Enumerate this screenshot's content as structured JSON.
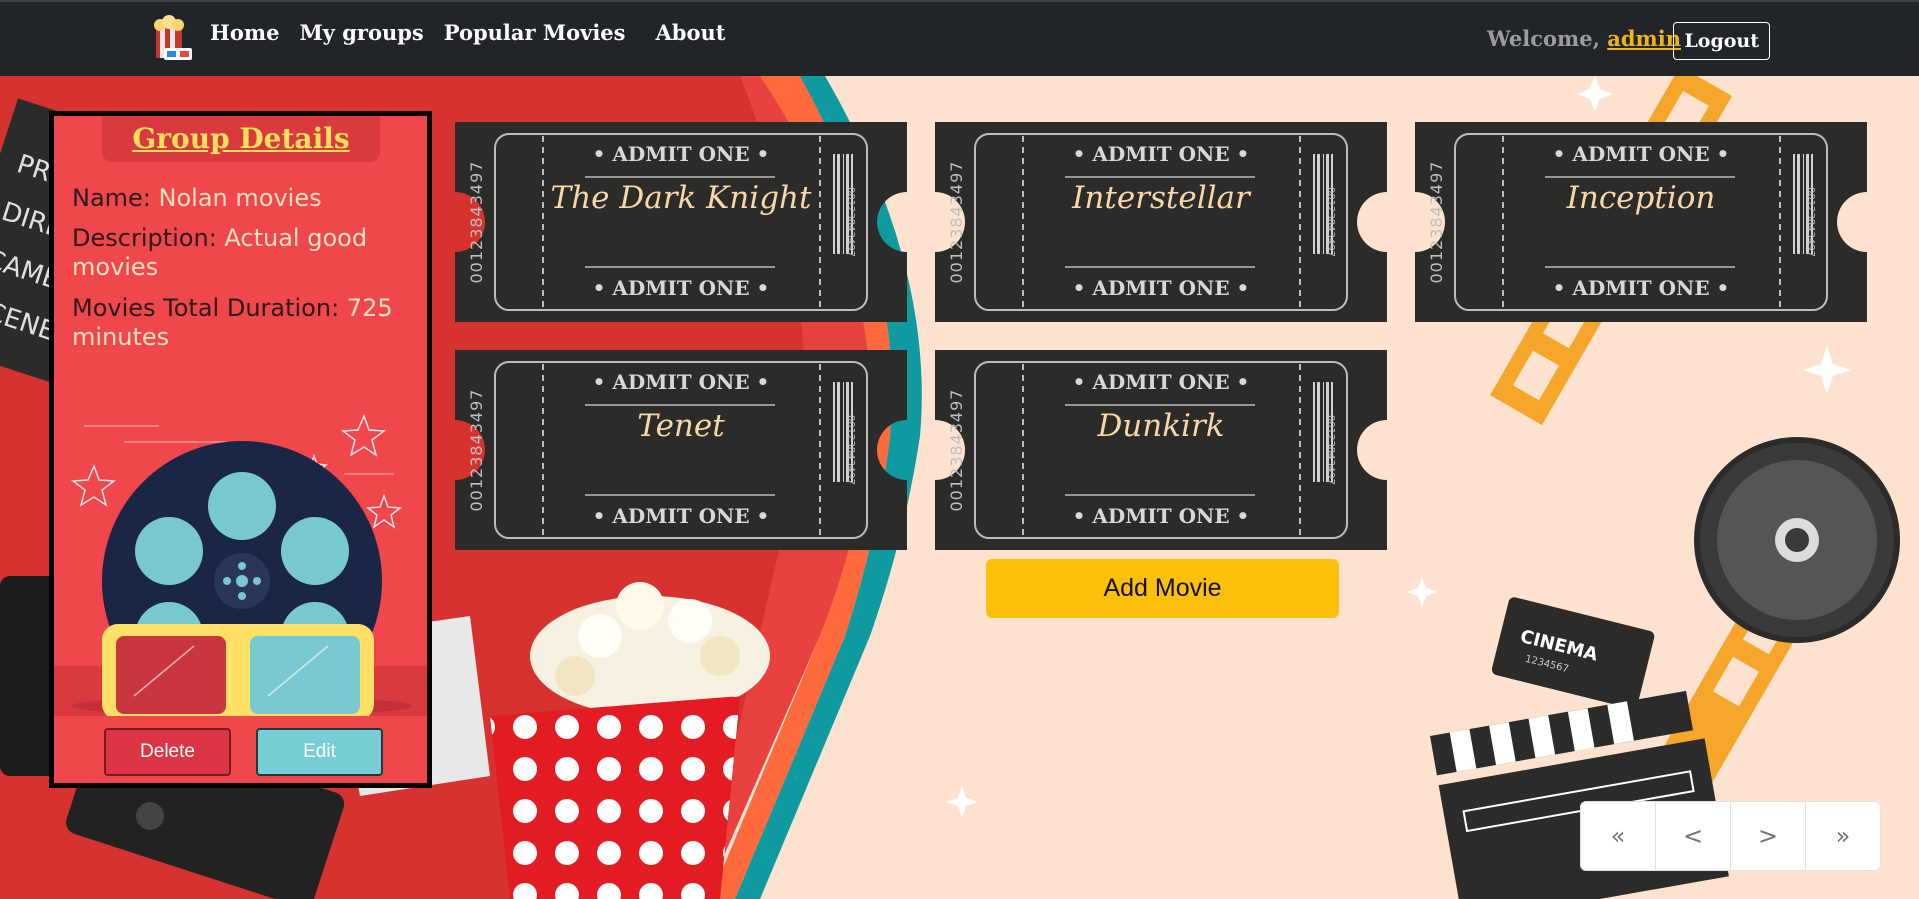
{
  "nav": {
    "links": [
      "Home",
      "My groups",
      "Popular Movies",
      "About"
    ],
    "welcome_prefix": "Welcome, ",
    "username": "admin",
    "logout_label": "Logout"
  },
  "group": {
    "title": "Group Details",
    "name_label": "Name: ",
    "name_value": "Nolan movies",
    "description_label": "Description: ",
    "description_value": "Actual good movies",
    "duration_label": "Movies Total Duration: ",
    "duration_value": "725 minutes",
    "delete_label": "Delete",
    "edit_label": "Edit"
  },
  "tickets": {
    "admit_text": "• ADMIT ONE •",
    "serial": "00123843497",
    "movies": [
      "The Dark Knight",
      "Interstellar",
      "Inception",
      "Tenet",
      "Dunkirk"
    ]
  },
  "add_movie_label": "Add Movie",
  "pagination": [
    "«",
    "<",
    ">",
    "»"
  ],
  "decor": {
    "cinema_ticket_text": "CINEMA",
    "cinema_ticket_number": "1234567"
  },
  "colors": {
    "navbar": "#21252a",
    "accent_yellow": "#fcbf0a",
    "panel_red": "#f0474d",
    "delete_red": "#dc3545",
    "edit_teal": "#76cdd3",
    "ticket_dark": "#2b2b29"
  }
}
